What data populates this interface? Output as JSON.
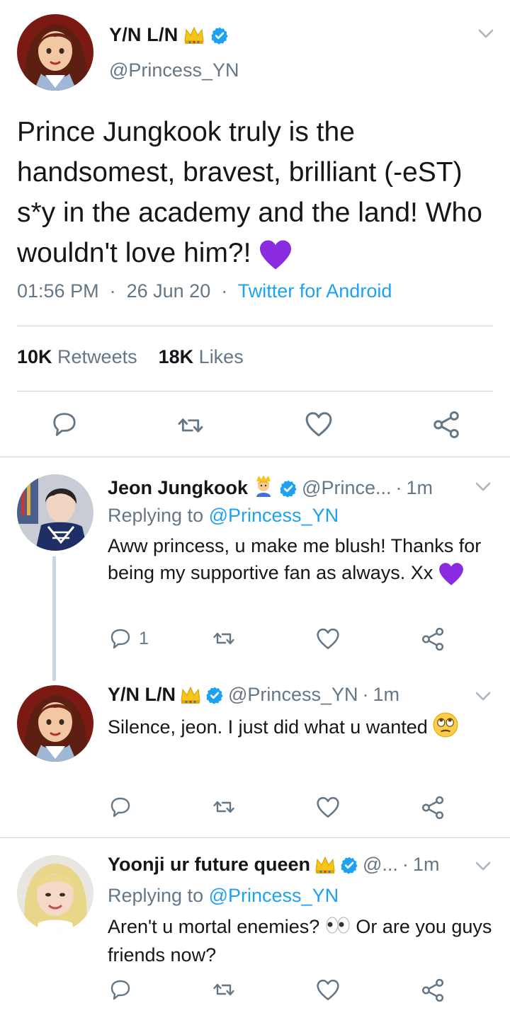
{
  "main_tweet": {
    "name": "Y/N L/N",
    "handle": "@Princess_YN",
    "text": "Prince Jungkook truly is the handsomest, bravest, brilliant (-eST) s*y in the academy and the land! Who wouldn't love him?!",
    "time": "01:56 PM",
    "date": "26 Jun 20",
    "source": "Twitter for Android",
    "retweets_count": "10K",
    "retweets_label": "Retweets",
    "likes_count": "18K",
    "likes_label": "Likes",
    "emojis": [
      "crown",
      "purple-heart"
    ]
  },
  "replies": [
    {
      "name": "Jeon Jungkook",
      "handle": "@Prince...",
      "time": "1m",
      "replying_label": "Replying to",
      "replying_to": "@Princess_YN",
      "text": "Aww princess, u make me blush! Thanks for being my supportive fan as always. Xx",
      "reply_count": "1",
      "emojis": [
        "prince",
        "purple-heart"
      ]
    },
    {
      "name": "Y/N L/N",
      "handle": "@Princess_YN",
      "time": "1m",
      "text": "Silence, jeon. I just did what u wanted",
      "emojis": [
        "crown",
        "eye-roll"
      ]
    },
    {
      "name": "Yoonji ur future queen",
      "handle": "@...",
      "time": "1m",
      "replying_label": "Replying to",
      "replying_to": "@Princess_YN",
      "text_part1": "Aren't u mortal enemies?",
      "text_part2": "Or are you guys friends now?",
      "emojis": [
        "crown",
        "eyes"
      ]
    }
  ],
  "colors": {
    "link_blue": "#1da1f2",
    "secondary_gray": "#657786",
    "verified_blue": "#1da1f2",
    "purple_heart": "#8a2be2"
  }
}
